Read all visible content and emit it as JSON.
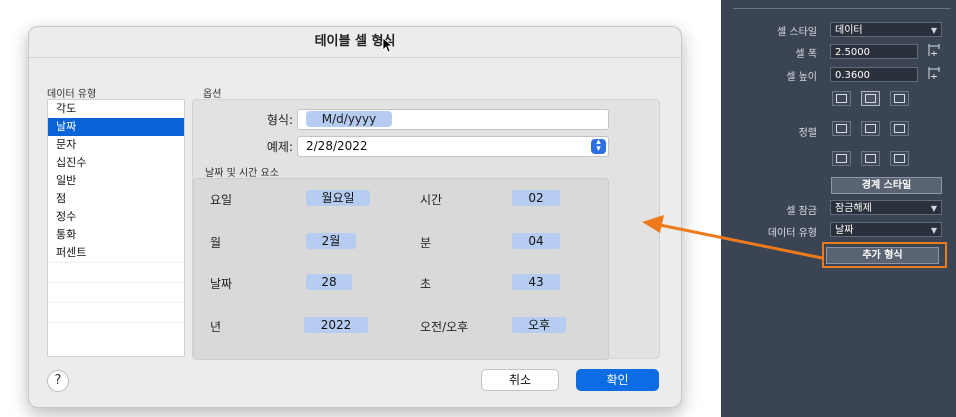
{
  "dialog": {
    "title": "테이블 셀 형식",
    "data_type_header": "데이터 유형",
    "data_types": [
      "각도",
      "날짜",
      "문자",
      "십진수",
      "일반",
      "점",
      "정수",
      "통화",
      "퍼센트"
    ],
    "selected_type": "날짜",
    "options_header": "옵션",
    "format_label": "형식:",
    "format_value": "M/d/yyyy",
    "example_label": "예제:",
    "example_value": "2/28/2022",
    "elements_header": "날짜 및 시간 요소",
    "elements": {
      "weekday": {
        "label": "요일",
        "value": "월요일"
      },
      "month": {
        "label": "월",
        "value": "2월"
      },
      "day": {
        "label": "날짜",
        "value": "28"
      },
      "year": {
        "label": "년",
        "value": "2022"
      },
      "hour": {
        "label": "시간",
        "value": "02"
      },
      "minute": {
        "label": "분",
        "value": "04"
      },
      "second": {
        "label": "초",
        "value": "43"
      },
      "ampm": {
        "label": "오전/오후",
        "value": "오후"
      }
    },
    "help_label": "?",
    "cancel_label": "취소",
    "ok_label": "확인"
  },
  "properties": {
    "cell_style_label": "셀 스타일",
    "cell_style_value": "데이터",
    "cell_width_label": "셀 폭",
    "cell_width_value": "2.5000",
    "cell_height_label": "셀 높이",
    "cell_height_value": "0.3600",
    "align_label": "정렬",
    "border_style_button": "경계 스타일",
    "cell_lock_label": "셀 잠금",
    "cell_lock_value": "잠금해제",
    "data_type_label": "데이터 유형",
    "data_type_value": "날짜",
    "add_format_button": "추가 형식"
  },
  "colors": {
    "accent": "#0a63d6",
    "highlight": "#ee7a1b",
    "panel_dark": "#3b4452"
  },
  "icons": [
    "mouse-pointer-icon",
    "pick-width-icon",
    "pick-height-icon",
    "align-grid-icons",
    "chevron-down-icon",
    "up-down-chevron-icon"
  ]
}
